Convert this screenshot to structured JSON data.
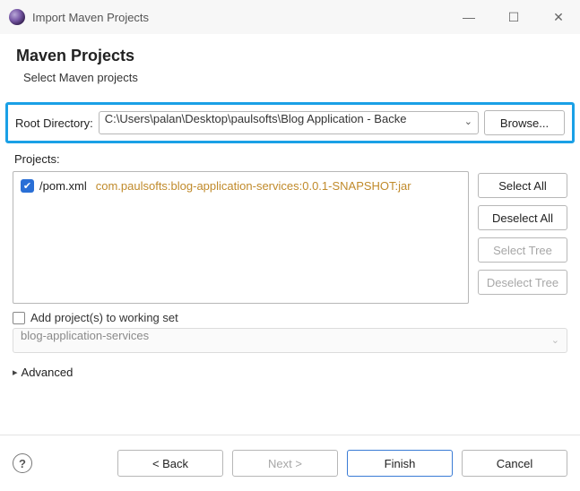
{
  "window": {
    "title": "Import Maven Projects"
  },
  "header": {
    "title": "Maven Projects",
    "subtitle": "Select Maven projects"
  },
  "root_directory": {
    "label": "Root Directory:",
    "value": "C:\\Users\\palan\\Desktop\\paulsofts\\Blog Application - Backe",
    "browse_label": "Browse..."
  },
  "projects": {
    "label": "Projects:",
    "items": [
      {
        "checked": true,
        "file": "/pom.xml",
        "coords": "com.paulsofts:blog-application-services:0.0.1-SNAPSHOT:jar"
      }
    ],
    "side_buttons": {
      "select_all": "Select All",
      "deselect_all": "Deselect All",
      "select_tree": "Select Tree",
      "deselect_tree": "Deselect Tree"
    }
  },
  "working_set": {
    "checkbox_label": "Add project(s) to working set",
    "value": "blog-application-services"
  },
  "advanced": {
    "label": "Advanced"
  },
  "wizard": {
    "help": "?",
    "back": "< Back",
    "next": "Next >",
    "finish": "Finish",
    "cancel": "Cancel"
  }
}
